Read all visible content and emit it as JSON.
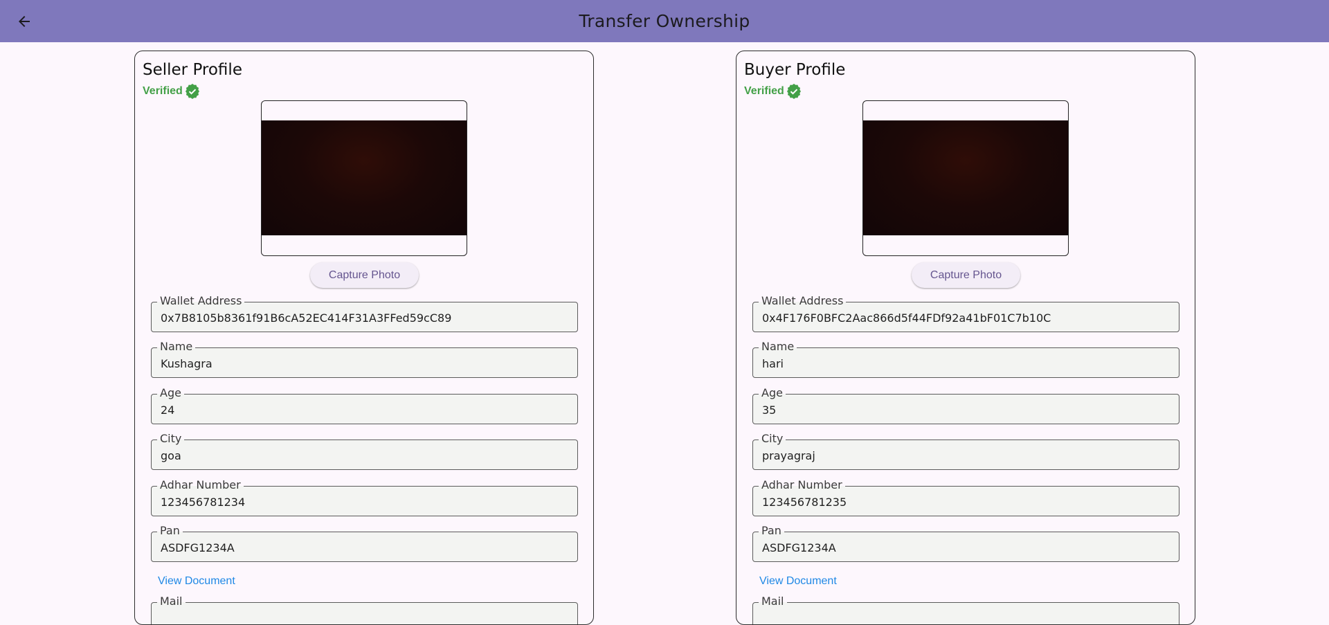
{
  "appbar": {
    "title": "Transfer Ownership",
    "back_icon": "arrow-back-icon"
  },
  "colors": {
    "appbar": "#7f78bc",
    "verified": "#43a047",
    "link": "#1e88e5",
    "button_text": "#65558f"
  },
  "seller": {
    "heading": "Seller Profile",
    "verified": "Verified",
    "capture_label": "Capture Photo",
    "view_document": "View Document",
    "fields": {
      "wallet": {
        "label": "Wallet Address",
        "value": "0x7B8105b8361f91B6cA52EC414F31A3FFed59cC89"
      },
      "name": {
        "label": "Name",
        "value": "Kushagra"
      },
      "age": {
        "label": "Age",
        "value": "24"
      },
      "city": {
        "label": "City",
        "value": "goa"
      },
      "adhar": {
        "label": "Adhar Number",
        "value": "123456781234"
      },
      "pan": {
        "label": "Pan",
        "value": "ASDFG1234A"
      },
      "mail": {
        "label": "Mail",
        "value": ""
      }
    }
  },
  "buyer": {
    "heading": "Buyer Profile",
    "verified": "Verified",
    "capture_label": "Capture Photo",
    "view_document": "View Document",
    "fields": {
      "wallet": {
        "label": "Wallet Address",
        "value": "0x4F176F0BFC2Aac866d5f44FDf92a41bF01C7b10C"
      },
      "name": {
        "label": "Name",
        "value": "hari"
      },
      "age": {
        "label": "Age",
        "value": "35"
      },
      "city": {
        "label": "City",
        "value": "prayagraj"
      },
      "adhar": {
        "label": "Adhar Number",
        "value": "123456781235"
      },
      "pan": {
        "label": "Pan",
        "value": "ASDFG1234A"
      },
      "mail": {
        "label": "Mail",
        "value": ""
      }
    }
  }
}
